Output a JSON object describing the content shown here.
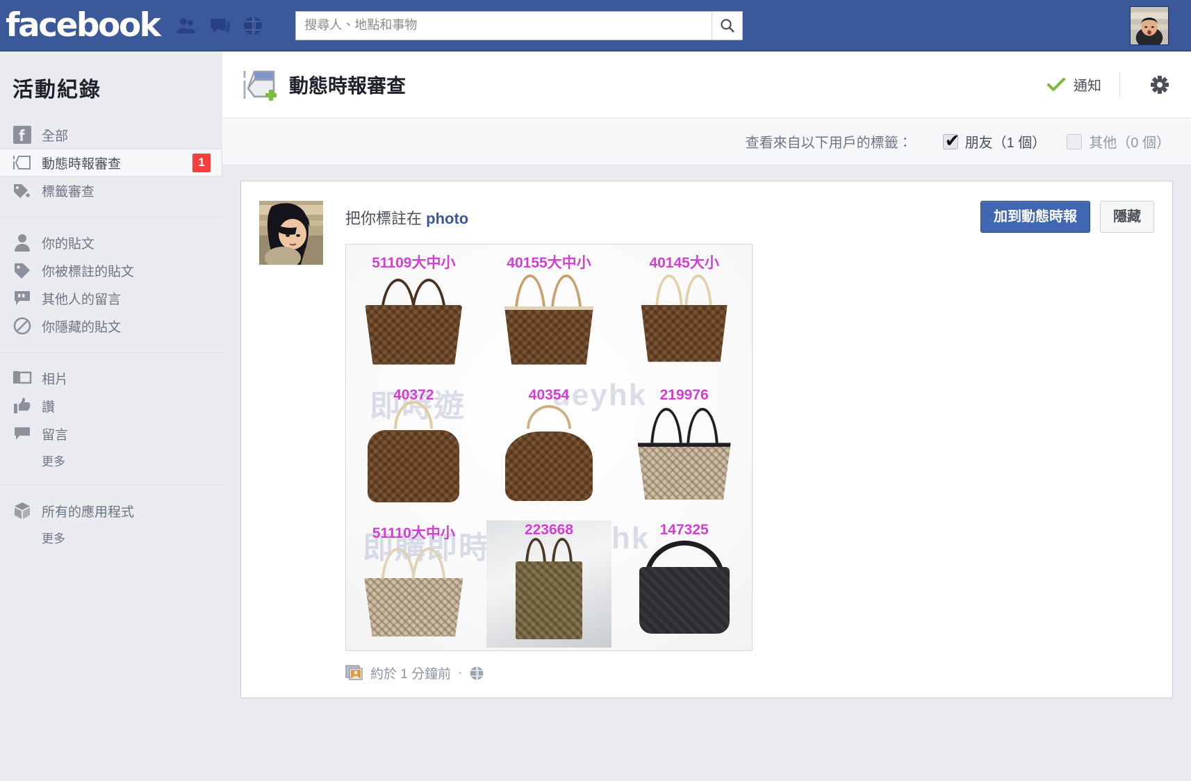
{
  "topnav": {
    "logo": "facebook",
    "icons": [
      "friend-requests-icon",
      "messages-icon",
      "notifications-globe-icon"
    ],
    "search": {
      "placeholder": "搜尋人、地點和事物",
      "value": "",
      "button_icon": "search-icon"
    },
    "avatar_alt": "profile-photo"
  },
  "sidebar": {
    "title": "活動紀錄",
    "groups": [
      {
        "items": [
          {
            "icon": "facebook-f-icon",
            "label": "全部",
            "selected": false,
            "badge": ""
          },
          {
            "icon": "timeline-review-icon",
            "label": "動態時報審查",
            "selected": true,
            "badge": "1"
          },
          {
            "icon": "tag-plus-icon",
            "label": "標籤審查",
            "selected": false,
            "badge": ""
          }
        ],
        "more": ""
      },
      {
        "items": [
          {
            "icon": "person-icon",
            "label": "你的貼文",
            "selected": false,
            "badge": ""
          },
          {
            "icon": "tag-icon",
            "label": "你被標註的貼文",
            "selected": false,
            "badge": ""
          },
          {
            "icon": "comment-bubble-icon",
            "label": "其他人的留言",
            "selected": false,
            "badge": ""
          },
          {
            "icon": "hidden-ban-icon",
            "label": "你隱藏的貼文",
            "selected": false,
            "badge": ""
          }
        ],
        "more": ""
      },
      {
        "items": [
          {
            "icon": "photos-icon",
            "label": "相片",
            "selected": false,
            "badge": ""
          },
          {
            "icon": "thumbs-up-icon",
            "label": "讚",
            "selected": false,
            "badge": ""
          },
          {
            "icon": "comment-icon",
            "label": "留言",
            "selected": false,
            "badge": ""
          }
        ],
        "more": "更多"
      },
      {
        "items": [
          {
            "icon": "apps-cube-icon",
            "label": "所有的應用程式",
            "selected": false,
            "badge": ""
          }
        ],
        "more": "更多"
      }
    ]
  },
  "main": {
    "header": {
      "icon": "timeline-review-icon",
      "title": "動態時報審查",
      "notify_label": "通知",
      "notify_icon": "green-check-icon",
      "gear_icon": "gear-icon"
    },
    "filterbar": {
      "label": "查看來自以下用戶的標籤：",
      "options": [
        {
          "label": "朋友（1 個）",
          "checked": true
        },
        {
          "label": "其他（0 個）",
          "checked": false
        }
      ]
    },
    "story": {
      "avatar_alt": "tagger-profile-photo",
      "text_prefix": "把你標註在 ",
      "text_link": "photo",
      "primary_button": "加到動態時報",
      "secondary_button": "隱藏",
      "timestamp": "約於 1 分鐘前",
      "separator": "·",
      "privacy_icon": "public-globe-icon",
      "album_icon": "photo-album-icon",
      "photo": {
        "alt": "handbag-catalog-photo",
        "watermarks": [
          "即時遊",
          "ueyhk",
          "即購即時遊：",
          "ueyhk"
        ],
        "code_color": "#d13fd1",
        "items": [
          {
            "code": "51109大中小",
            "style": "damier-tote"
          },
          {
            "code": "40155大中小",
            "style": "monogram-tote"
          },
          {
            "code": "40145大小",
            "style": "monogram-shoulder"
          },
          {
            "code": "40372",
            "style": "monogram-bucket"
          },
          {
            "code": "40354",
            "style": "monogram-hobo"
          },
          {
            "code": "219976",
            "style": "beige-tote-dark-trim"
          },
          {
            "code": "51110大中小",
            "style": "beige-damier-tote"
          },
          {
            "code": "223668",
            "style": "khaki-vertical-tote"
          },
          {
            "code": "147325",
            "style": "black-messenger"
          }
        ]
      }
    }
  }
}
